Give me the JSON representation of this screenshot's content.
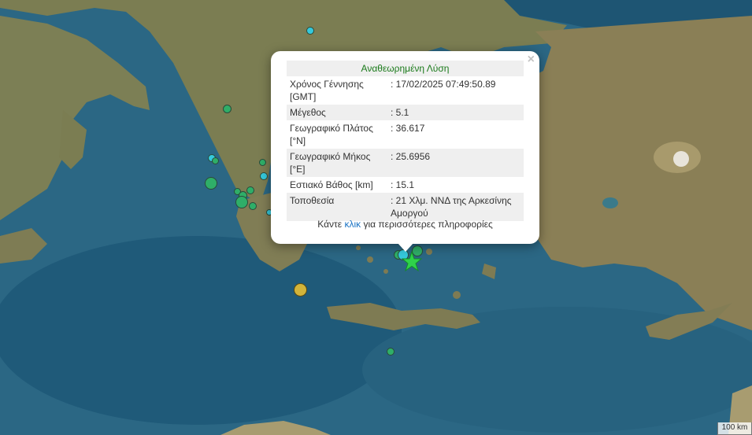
{
  "popup": {
    "title": "Αναθεωρημένη Λύση",
    "close_glyph": "×",
    "rows": [
      {
        "label": "Χρόνος Γέννησης [GMT]",
        "value": ": 17/02/2025 07:49:50.89"
      },
      {
        "label": "Μέγεθος",
        "value": ": 5.1"
      },
      {
        "label": "Γεωγραφικό Πλάτος [°N]",
        "value": ": 36.617"
      },
      {
        "label": "Γεωγραφικό Μήκος [°E]",
        "value": ": 25.6956"
      },
      {
        "label": "Εστιακό Βάθος [km]",
        "value": ": 15.1"
      },
      {
        "label": "Τοποθεσία",
        "value": ": 21 Χλμ. ΝΝΔ της Αρκεσίνης Αμοργού"
      }
    ],
    "footer_prefix": "Κάντε",
    "footer_link": "κλικ",
    "footer_suffix": "για περισσότερες πληροφορίες"
  },
  "scale_label": "100 km",
  "colors": {
    "sea": "#2b6784",
    "land": "#7a7a52",
    "marker_green": "#2fae68",
    "marker_cyan": "#35c9dc",
    "marker_yellow": "#d2b43a",
    "star": "#2fd24a"
  },
  "icons": {
    "selected_event": "star-icon",
    "close": "close-icon"
  }
}
